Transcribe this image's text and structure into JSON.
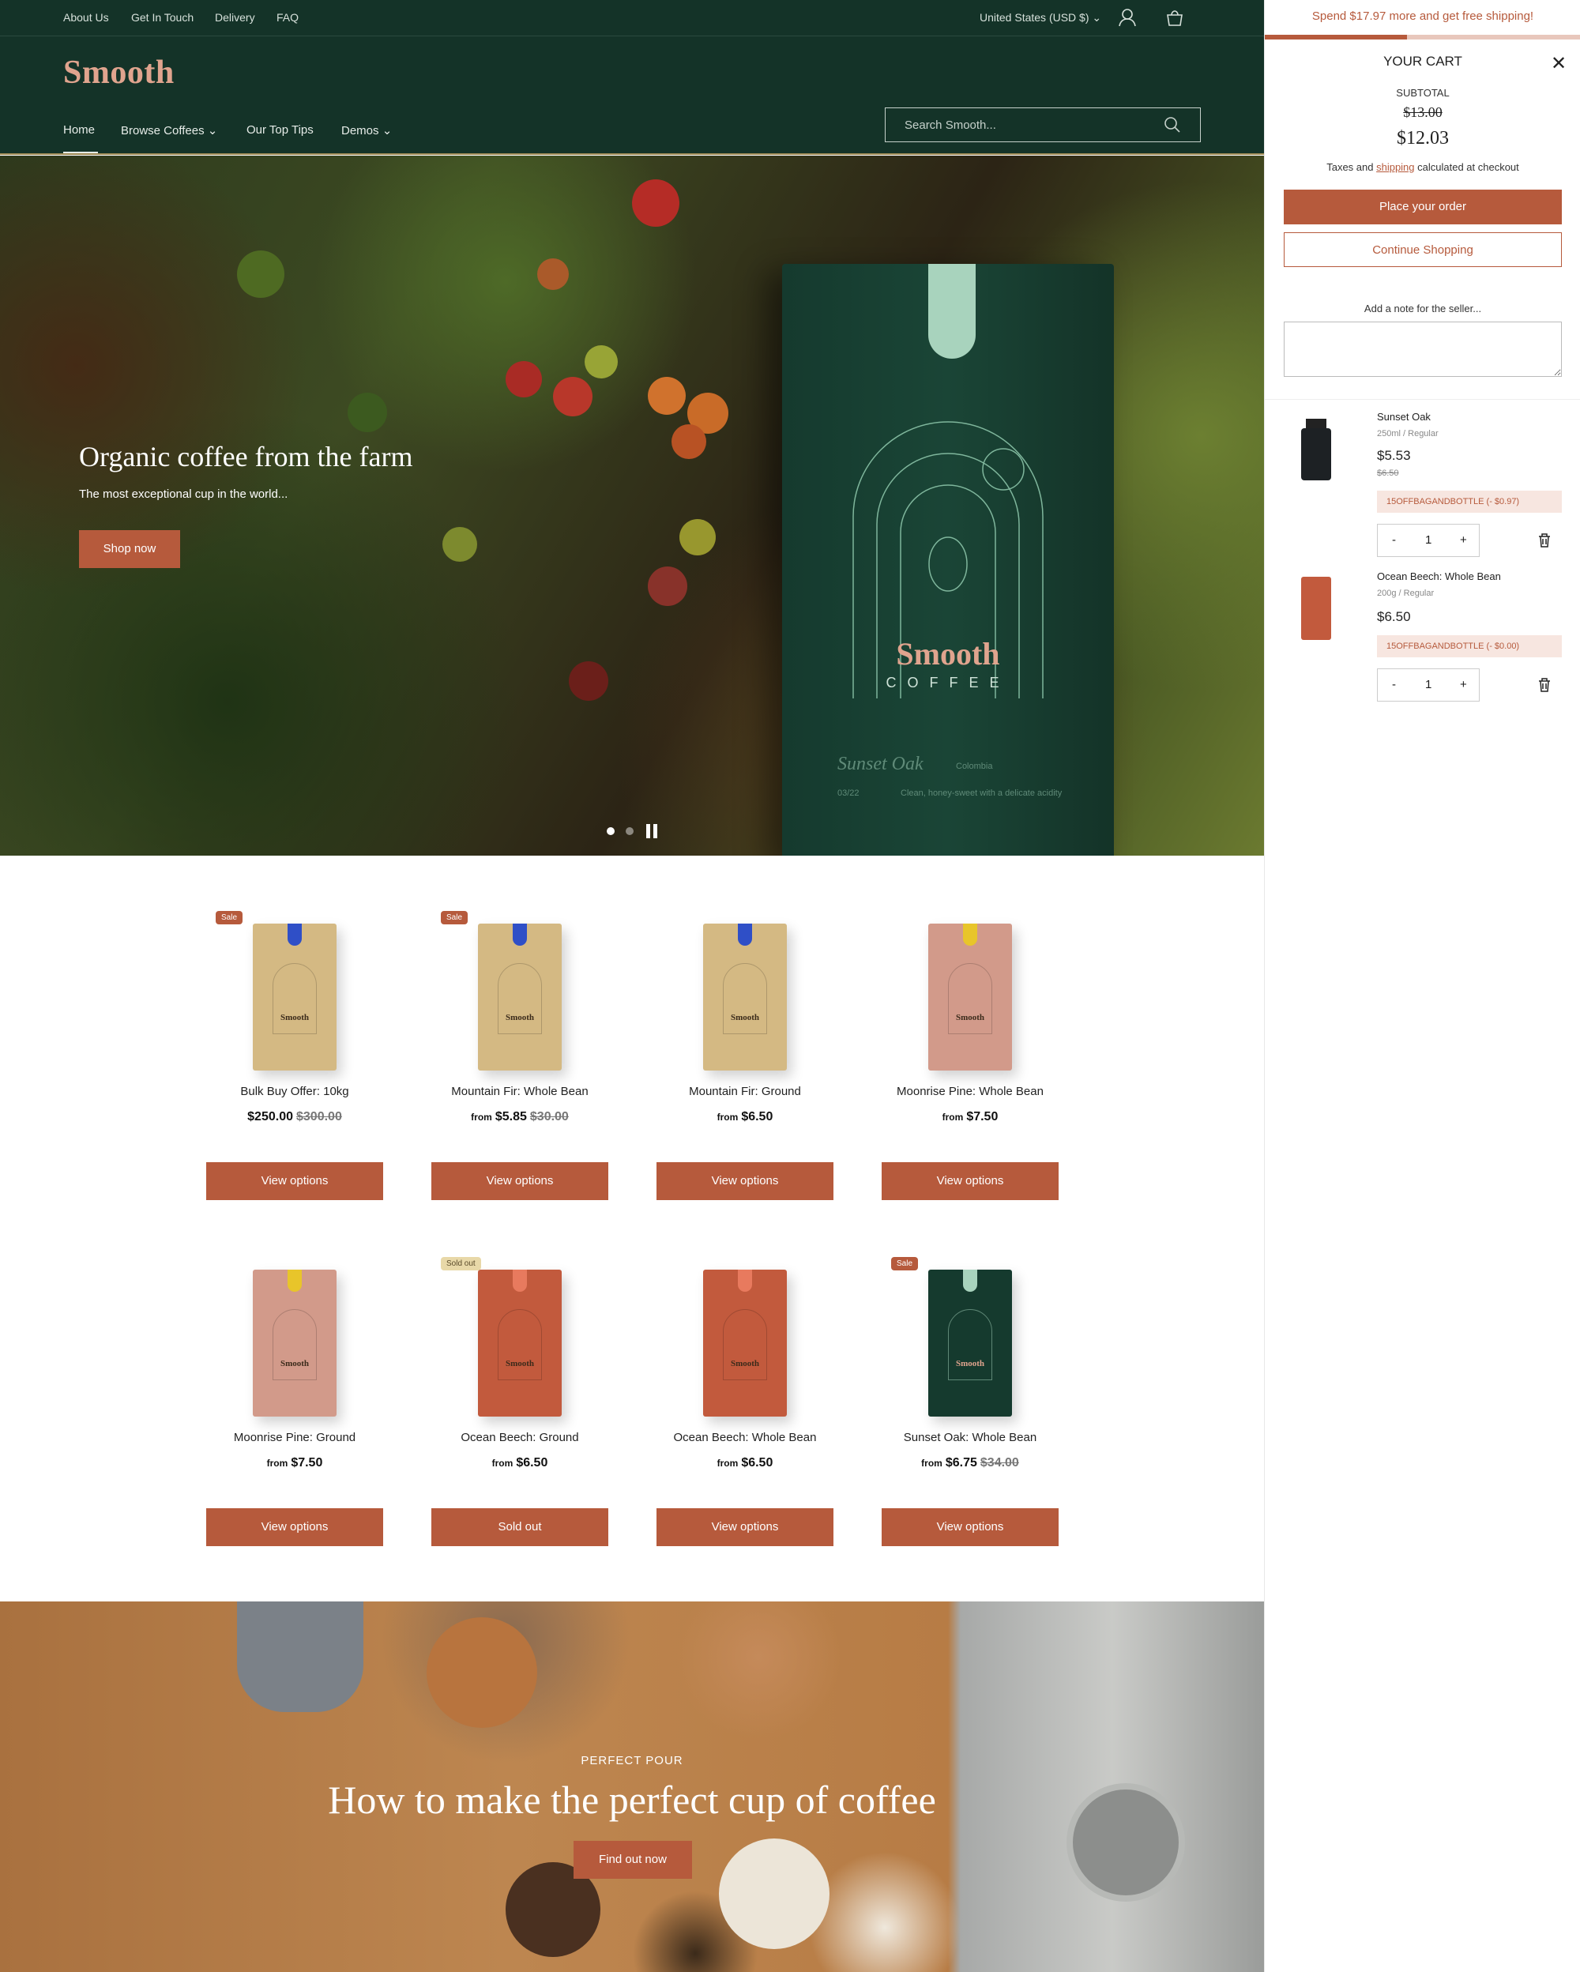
{
  "colors": {
    "brand_green": "#143328",
    "accent": "#b65a3c",
    "logo": "#e0a48e",
    "discount_bg": "#f7e6e0"
  },
  "topbar": {
    "links": [
      "About Us",
      "Get In Touch",
      "Delivery",
      "FAQ"
    ],
    "currency": "United States (USD $)"
  },
  "header": {
    "logo": "Smooth",
    "nav": [
      "Home",
      "Browse Coffees",
      "Our Top Tips",
      "Demos"
    ],
    "search_placeholder": "Search Smooth..."
  },
  "hero": {
    "title": "Organic coffee from the farm",
    "subtitle": "The most exceptional cup in the world...",
    "button": "Shop now",
    "bag_brand": "Smooth",
    "bag_sub": "COFFEE",
    "bag_script": "Sunset Oak",
    "bag_origin": "Colombia",
    "bag_date": "03/22",
    "bag_notes": "Clean, honey-sweet with a delicate acidity"
  },
  "products": [
    {
      "name": "Bulk Buy Offer: 10kg",
      "from": "",
      "price": "$250.00",
      "was": "$300.00",
      "badge": "Sale",
      "button": "View options",
      "bag": "#d4b983",
      "tab": "#2f4fc7"
    },
    {
      "name": "Mountain Fir: Whole Bean",
      "from": "from",
      "price": "$5.85",
      "was": "$30.00",
      "badge": "Sale",
      "button": "View options",
      "bag": "#d4b983",
      "tab": "#2f4fc7"
    },
    {
      "name": "Mountain Fir: Ground",
      "from": "from",
      "price": "$6.50",
      "was": "",
      "badge": "",
      "button": "View options",
      "bag": "#d4b983",
      "tab": "#2f4fc7"
    },
    {
      "name": "Moonrise Pine: Whole Bean",
      "from": "from",
      "price": "$7.50",
      "was": "",
      "badge": "",
      "button": "View options",
      "bag": "#d29a8a",
      "tab": "#e8c52a"
    },
    {
      "name": "Moonrise Pine: Ground",
      "from": "from",
      "price": "$7.50",
      "was": "",
      "badge": "",
      "button": "View options",
      "bag": "#d29a8a",
      "tab": "#e8c52a"
    },
    {
      "name": "Ocean Beech: Ground",
      "from": "from",
      "price": "$6.50",
      "was": "",
      "badge": "Sold out",
      "button": "Sold out",
      "bag": "#c25a3d",
      "tab": "#e87a5e"
    },
    {
      "name": "Ocean Beech: Whole Bean",
      "from": "from",
      "price": "$6.50",
      "was": "",
      "badge": "",
      "button": "View options",
      "bag": "#c25a3d",
      "tab": "#e87a5e"
    },
    {
      "name": "Sunset Oak: Whole Bean",
      "from": "from",
      "price": "$6.75",
      "was": "$34.00",
      "badge": "Sale",
      "button": "View options",
      "bag": "#153a2e",
      "tab": "#a8d3bd"
    }
  ],
  "pour": {
    "label": "PERFECT POUR",
    "title": "How to make the perfect cup of coffee",
    "button": "Find out now"
  },
  "cart": {
    "shipping_msg": "Spend $17.97 more and get free shipping!",
    "shipping_progress": 0.45,
    "title": "YOUR CART",
    "subtotal_label": "SUBTOTAL",
    "subtotal_was": "$13.00",
    "subtotal": "$12.03",
    "taxes_pre": "Taxes and ",
    "taxes_link": "shipping",
    "taxes_post": " calculated at checkout",
    "order_button": "Place your order",
    "continue_button": "Continue Shopping",
    "note_label": "Add a note for the seller...",
    "items": [
      {
        "name": "Sunset Oak",
        "variant": "250ml / Regular",
        "price": "$5.53",
        "was": "$6.50",
        "discount": "15OFFBAGANDBOTTLE (- $0.97)",
        "qty": "1"
      },
      {
        "name": "Ocean Beech: Whole Bean",
        "variant": "200g / Regular",
        "price": "$6.50",
        "was": "",
        "discount": "15OFFBAGANDBOTTLE (- $0.00)",
        "qty": "1"
      }
    ],
    "qty_minus": "-",
    "qty_plus": "+"
  }
}
